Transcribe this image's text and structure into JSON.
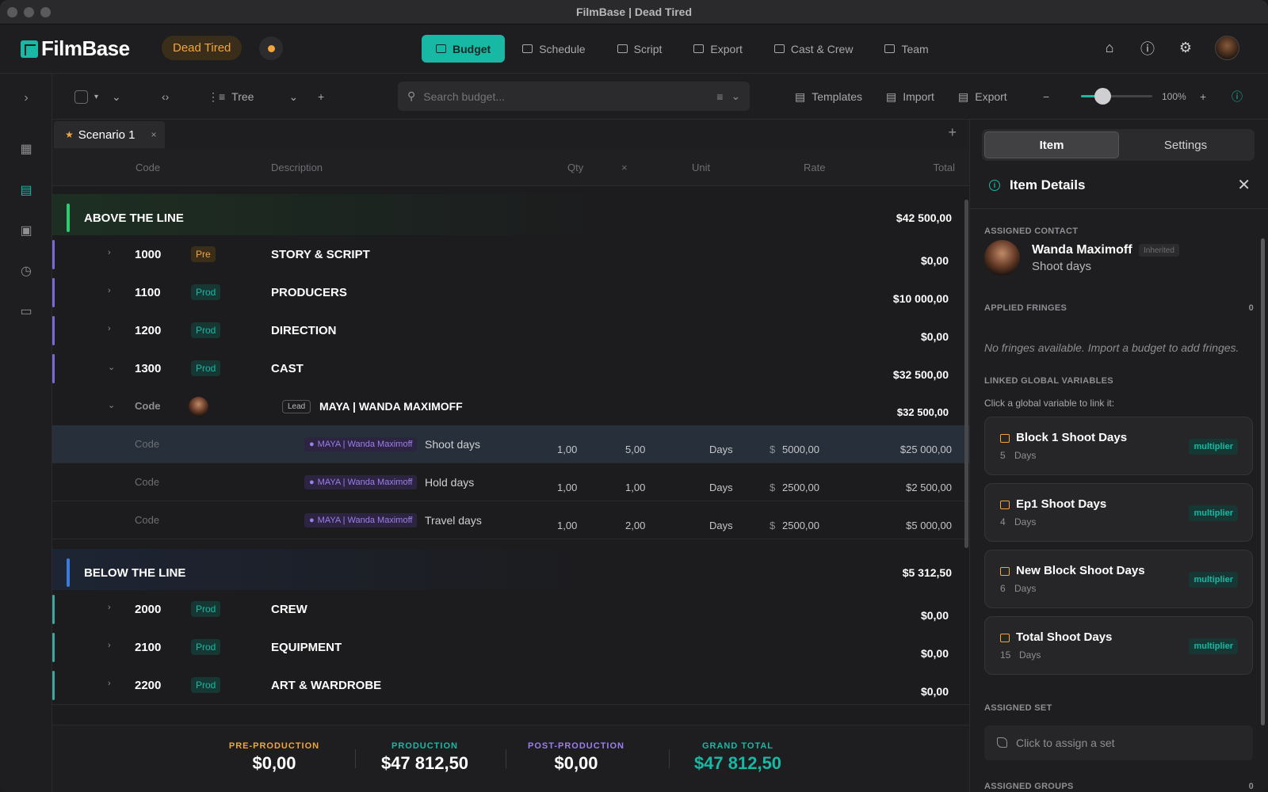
{
  "window": {
    "title": "FilmBase | Dead Tired"
  },
  "app": {
    "name": "FilmBase",
    "project": "Dead Tired"
  },
  "nav": {
    "tabs": [
      {
        "label": "Budget",
        "active": true
      },
      {
        "label": "Schedule"
      },
      {
        "label": "Script"
      },
      {
        "label": "Export"
      },
      {
        "label": "Cast & Crew"
      },
      {
        "label": "Team"
      }
    ]
  },
  "toolbar": {
    "view_label": "Tree",
    "search_placeholder": "Search budget...",
    "templates_label": "Templates",
    "import_label": "Import",
    "export_label": "Export",
    "zoom": "100%",
    "zoom_fraction": 0.3
  },
  "doc_tab": {
    "label": "Scenario 1"
  },
  "columns": {
    "code": "Code",
    "description": "Description",
    "qty": "Qty",
    "x": "×",
    "unit": "Unit",
    "rate": "Rate",
    "total": "Total"
  },
  "budget": {
    "above": {
      "label": "ABOVE THE LINE",
      "total": "$42 500,00",
      "color": "#2ecc71"
    },
    "above_accounts": [
      {
        "code": "1000",
        "phase": "Pre",
        "desc": "STORY & SCRIPT",
        "total": "$0,00"
      },
      {
        "code": "1100",
        "phase": "Prod",
        "desc": "PRODUCERS",
        "total": "$10 000,00"
      },
      {
        "code": "1200",
        "phase": "Prod",
        "desc": "DIRECTION",
        "total": "$0,00"
      },
      {
        "code": "1300",
        "phase": "Prod",
        "desc": "CAST",
        "total": "$32 500,00"
      }
    ],
    "sub_account": {
      "code": "Code",
      "badge": "Lead",
      "desc": "MAYA | WANDA MAXIMOFF",
      "total": "$32 500,00"
    },
    "lines": [
      {
        "code": "Code",
        "chip": "MAYA | Wanda Maximoff",
        "desc": "Shoot days",
        "qty": "1,00",
        "x": "5,00",
        "unit": "Days",
        "cur": "$",
        "rate": "5000,00",
        "total": "$25 000,00"
      },
      {
        "code": "Code",
        "chip": "MAYA | Wanda Maximoff",
        "desc": "Hold days",
        "qty": "1,00",
        "x": "1,00",
        "unit": "Days",
        "cur": "$",
        "rate": "2500,00",
        "total": "$2 500,00"
      },
      {
        "code": "Code",
        "chip": "MAYA | Wanda Maximoff",
        "desc": "Travel days",
        "qty": "1,00",
        "x": "2,00",
        "unit": "Days",
        "cur": "$",
        "rate": "2500,00",
        "total": "$5 000,00"
      }
    ],
    "below": {
      "label": "BELOW THE LINE",
      "total": "$5 312,50",
      "color": "#3b7bdc"
    },
    "below_accounts": [
      {
        "code": "2000",
        "phase": "Prod",
        "desc": "CREW",
        "total": "$0,00"
      },
      {
        "code": "2100",
        "phase": "Prod",
        "desc": "EQUIPMENT",
        "total": "$0,00"
      },
      {
        "code": "2200",
        "phase": "Prod",
        "desc": "ART & WARDROBE",
        "total": "$0,00"
      }
    ]
  },
  "footer": {
    "pre": {
      "label": "PRE-PRODUCTION",
      "value": "$0,00",
      "color": "#f0a63a"
    },
    "prod": {
      "label": "PRODUCTION",
      "value": "$47 812,50",
      "color": "#17b9a5"
    },
    "post": {
      "label": "POST-PRODUCTION",
      "value": "$0,00",
      "color": "#9d7ef0"
    },
    "grand": {
      "label": "GRAND TOTAL",
      "value": "$47 812,50",
      "color": "#17b9a5"
    }
  },
  "panel": {
    "tabs": {
      "item": "Item",
      "settings": "Settings"
    },
    "title": "Item Details",
    "assigned_contact_label": "ASSIGNED CONTACT",
    "contact": {
      "name": "Wanda Maximoff",
      "badge": "Inherited",
      "sub": "Shoot days"
    },
    "fringes_label": "APPLIED FRINGES",
    "fringes_count": "0",
    "fringes_empty": "No fringes available. Import a budget to add fringes.",
    "vars_label": "LINKED GLOBAL VARIABLES",
    "vars_hint": "Click a global variable to link it:",
    "variables": [
      {
        "name": "Block 1 Shoot Days",
        "value": "5",
        "unit": "Days",
        "tag": "multiplier"
      },
      {
        "name": "Ep1 Shoot Days",
        "value": "4",
        "unit": "Days",
        "tag": "multiplier"
      },
      {
        "name": "New Block Shoot Days",
        "value": "6",
        "unit": "Days",
        "tag": "multiplier"
      },
      {
        "name": "Total Shoot Days",
        "value": "15",
        "unit": "Days",
        "tag": "multiplier"
      }
    ],
    "set_label": "ASSIGNED SET",
    "set_placeholder": "Click to assign a set",
    "groups_label": "ASSIGNED GROUPS",
    "groups_count": "0"
  }
}
